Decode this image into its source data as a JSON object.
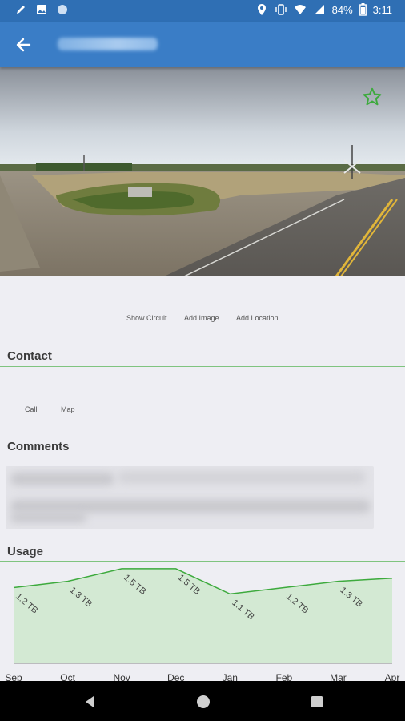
{
  "status_bar": {
    "battery": "84%",
    "time": "3:11"
  },
  "toolbar": {
    "back_icon": "arrow-left-icon"
  },
  "photo": {
    "favorite_icon": "star-outline-icon"
  },
  "actions": {
    "show_circuit": "Show Circuit",
    "add_image": "Add Image",
    "add_location": "Add Location"
  },
  "contact": {
    "heading": "Contact",
    "call": "Call",
    "map": "Map"
  },
  "comments": {
    "heading": "Comments"
  },
  "usage": {
    "heading": "Usage"
  },
  "colors": {
    "status_bar": "#2f6fb4",
    "toolbar": "#3a7dc6",
    "accent_green": "#3daa3d",
    "chart_fill": "#d3e9d3"
  },
  "chart_data": {
    "type": "area",
    "categories": [
      "Sep",
      "Oct",
      "Nov",
      "Dec",
      "Jan",
      "Feb",
      "Mar",
      "Apr"
    ],
    "values": [
      1.2,
      1.3,
      1.5,
      1.5,
      1.1,
      1.2,
      1.3,
      1.35
    ],
    "data_labels": [
      "1.2 TB",
      "1.3 TB",
      "1.5 TB",
      "1.5 TB",
      "1.1 TB",
      "1.2 TB",
      "1.3 TB",
      ""
    ],
    "ylim": [
      0,
      1.6
    ],
    "grid": false,
    "legend": "none"
  }
}
